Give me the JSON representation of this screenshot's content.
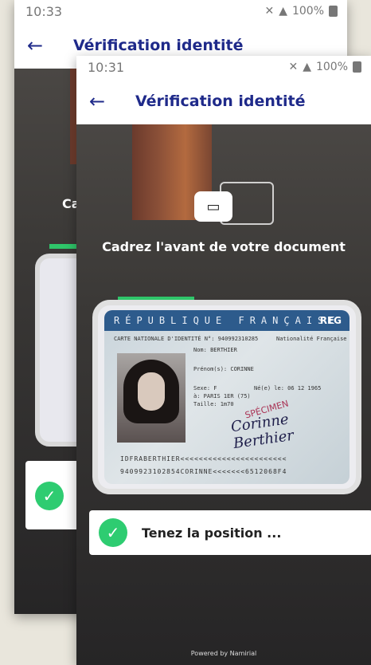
{
  "back_screen": {
    "time": "10:33",
    "battery": "100%",
    "title": "Vérification identité",
    "partial_label": "Ca"
  },
  "front_screen": {
    "time": "10:31",
    "battery": "100%",
    "title": "Vérification identité",
    "instruction": "Cadrez l'avant de votre document",
    "toast": "Tenez la position ...",
    "powered_by": "Powered by Namirial",
    "card": {
      "header": "RÉPUBLIQUE FRANÇAISE",
      "reg": "REG",
      "id_line": "CARTE NATIONALE D'IDENTITÉ N°: 940992310285",
      "nationality": "Nationalité Française",
      "nom": "Nom: BERTHIER",
      "prenom": "Prénom(s): CORINNE",
      "sexe": "Sexe: F",
      "ne_le": "Né(e) le: 06 12 1965",
      "lieu": "à: PARIS 1ER (75)",
      "taille": "Taille: 1m70",
      "signature": "Corinne Berthier",
      "specimen": "SPÉCIMEN",
      "mrz_1": "IDFRABERTHIER<<<<<<<<<<<<<<<<<<<<<<<",
      "mrz_2": "9409923102854CORINNE<<<<<<<6512068F4"
    }
  },
  "colors": {
    "accent": "#1f2a8a",
    "success": "#2ecc71",
    "progress": "#2fc66a"
  }
}
